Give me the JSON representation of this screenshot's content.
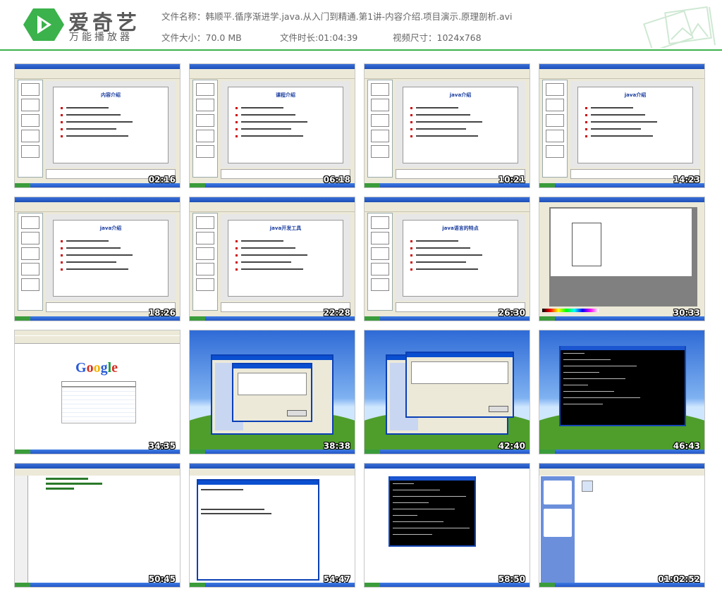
{
  "brand": {
    "name": "爱奇艺",
    "subtitle": "万能播放器",
    "primary_color": "#3bb24b"
  },
  "file_info": {
    "name_label": "文件名称：",
    "name_value": "韩顺平.循序渐进学.java.从入门到精通.第1讲-内容介绍.项目演示.原理剖析.avi",
    "size_label": "文件大小：",
    "size_value": "70.0 MB",
    "duration_label": "文件时长:",
    "duration_value": "01:04:39",
    "resolution_label": "视频尺寸：",
    "resolution_value": "1024x768"
  },
  "thumbnails": [
    {
      "time": "02:16",
      "kind": "ppt",
      "title": "内容介绍"
    },
    {
      "time": "06:18",
      "kind": "ppt",
      "title": "课程介绍"
    },
    {
      "time": "10:21",
      "kind": "ppt",
      "title": "java介绍"
    },
    {
      "time": "14:23",
      "kind": "ppt",
      "title": "java介绍"
    },
    {
      "time": "18:26",
      "kind": "ppt",
      "title": "java介绍"
    },
    {
      "time": "22:28",
      "kind": "ppt",
      "title": "java开发工具"
    },
    {
      "time": "26:30",
      "kind": "ppt",
      "title": "java语言的特点"
    },
    {
      "time": "30:33",
      "kind": "paint",
      "title": ""
    },
    {
      "time": "34:35",
      "kind": "browser",
      "title": "Google"
    },
    {
      "time": "38:38",
      "kind": "installer",
      "title": ""
    },
    {
      "time": "42:40",
      "kind": "installer2",
      "title": ""
    },
    {
      "time": "46:43",
      "kind": "console",
      "title": ""
    },
    {
      "time": "50:45",
      "kind": "editor",
      "title": ""
    },
    {
      "time": "54:47",
      "kind": "explorer",
      "title": ""
    },
    {
      "time": "58:50",
      "kind": "console2",
      "title": ""
    },
    {
      "time": "01:02:52",
      "kind": "desktop",
      "title": ""
    }
  ]
}
